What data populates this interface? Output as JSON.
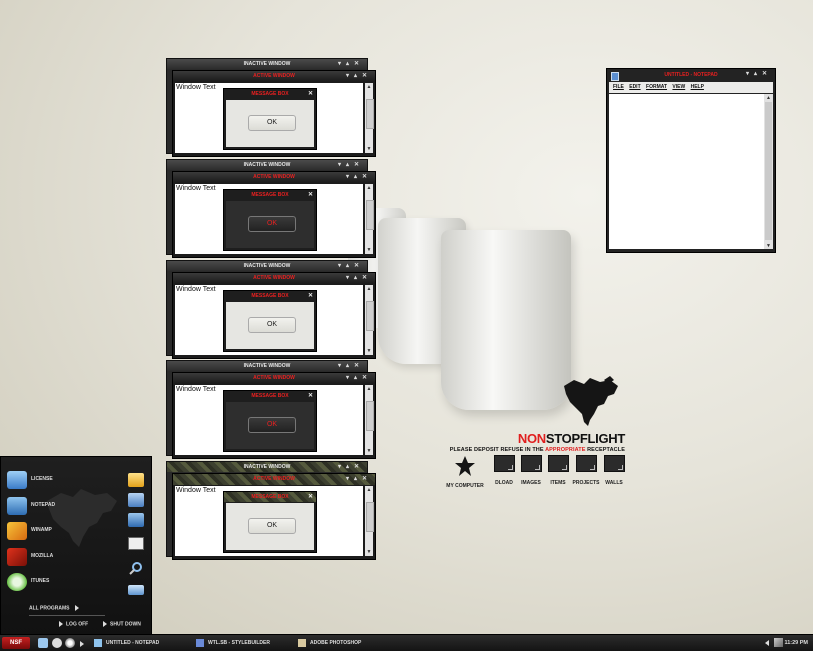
{
  "windows": {
    "inactive_title": "INACTIVE WINDOW",
    "active_title": "ACTIVE WINDOW",
    "window_text": "Window Text",
    "message_title": "MESSAGE BOX",
    "ok_label": "OK"
  },
  "notepad": {
    "title": "UNTITLED - NOTEPAD",
    "menu": [
      "FILE",
      "EDIT",
      "FORMAT",
      "VIEW",
      "HELP"
    ]
  },
  "brand": {
    "name_red": "NON",
    "name_rest": "STOPFLIGHT",
    "tagline_pre": "PLEASE DEPOSIT REFUSE IN THE ",
    "tagline_red": "APPROPRIATE",
    "tagline_post": " RECEPTACLE"
  },
  "desktop_icons": [
    "MY COMPUTER",
    "DLOAD",
    "IMAGES",
    "ITEMS",
    "PROJECTS",
    "WALLS"
  ],
  "start_menu": {
    "items": [
      "LICENSE",
      "NOTEPAD",
      "WINAMP",
      "MOZILLA",
      "ITUNES"
    ],
    "all_programs": "ALL PROGRAMS",
    "log_off": "LOG OFF",
    "shut_down": "SHUT DOWN"
  },
  "taskbar": {
    "tasks": [
      "UNTITLED - NOTEPAD",
      "WTL.SB - STYLEBUILDER",
      "ADOBE PHOTOSHOP"
    ],
    "clock": "11:29 PM"
  },
  "colors": {
    "accent_red": "#e01e1e",
    "chrome_dark": "#1c1c1c"
  }
}
